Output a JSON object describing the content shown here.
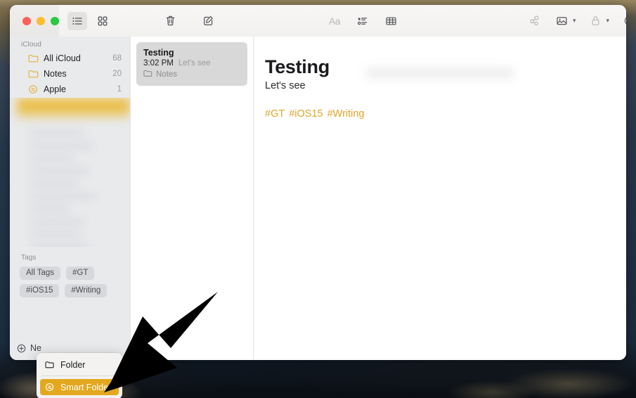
{
  "window": {
    "traffic_lights": [
      "close",
      "minimize",
      "zoom"
    ]
  },
  "toolbar": {
    "left_items": [
      {
        "name": "list-view",
        "icon": "list-view-icon",
        "active": true
      },
      {
        "name": "gallery-view",
        "icon": "grid-view-icon",
        "active": false
      }
    ],
    "middle_items": [
      {
        "name": "delete-note",
        "icon": "trash-icon"
      },
      {
        "name": "compose-note",
        "icon": "compose-icon"
      }
    ],
    "format_items": [
      {
        "name": "format-text",
        "icon": "aa-icon",
        "label": "Aa"
      },
      {
        "name": "checklist",
        "icon": "checklist-icon"
      },
      {
        "name": "table",
        "icon": "table-icon"
      }
    ],
    "right_items": [
      {
        "name": "quick-note-link",
        "icon": "link-icon"
      },
      {
        "name": "insert-media",
        "icon": "photo-icon",
        "chevron": true
      },
      {
        "name": "lock-note",
        "icon": "lock-icon",
        "chevron": true
      },
      {
        "name": "collaborate",
        "icon": "add-person-icon"
      },
      {
        "name": "share",
        "icon": "share-icon"
      },
      {
        "name": "search",
        "icon": "search-icon"
      }
    ]
  },
  "sidebar": {
    "section_title": "iCloud",
    "items": [
      {
        "label": "All iCloud",
        "count": "68",
        "icon": "folder-icon"
      },
      {
        "label": "Notes",
        "count": "20",
        "icon": "folder-icon"
      },
      {
        "label": "Apple",
        "count": "1",
        "icon": "smart-folder-icon"
      }
    ],
    "tags_title": "Tags",
    "tags": [
      "All Tags",
      "#GT",
      "#iOS15",
      "#Writing"
    ],
    "new_folder_label": "Ne"
  },
  "note_list": {
    "notes": [
      {
        "title": "Testing",
        "time": "3:02 PM",
        "preview": "Let's see",
        "folder": "Notes",
        "selected": true
      }
    ]
  },
  "editor": {
    "heading": "Testing",
    "subtitle": "Let's see",
    "hashtags": [
      "#GT",
      "#iOS15",
      "#Writing"
    ]
  },
  "context_menu": {
    "items": [
      {
        "label": "Folder",
        "icon": "folder-outline-icon",
        "selected": false
      },
      {
        "label": "Smart Folder",
        "icon": "smart-folder-icon",
        "selected": true
      }
    ]
  },
  "colors": {
    "accent_gold": "#e3a81f",
    "hashtag_gold": "#e0a42a",
    "folder_yellow": "#e3b23c",
    "sidebar_bg": "#e9eaec",
    "selected_note_bg": "#d8d8d8",
    "desktop_blue": "#24374c"
  }
}
